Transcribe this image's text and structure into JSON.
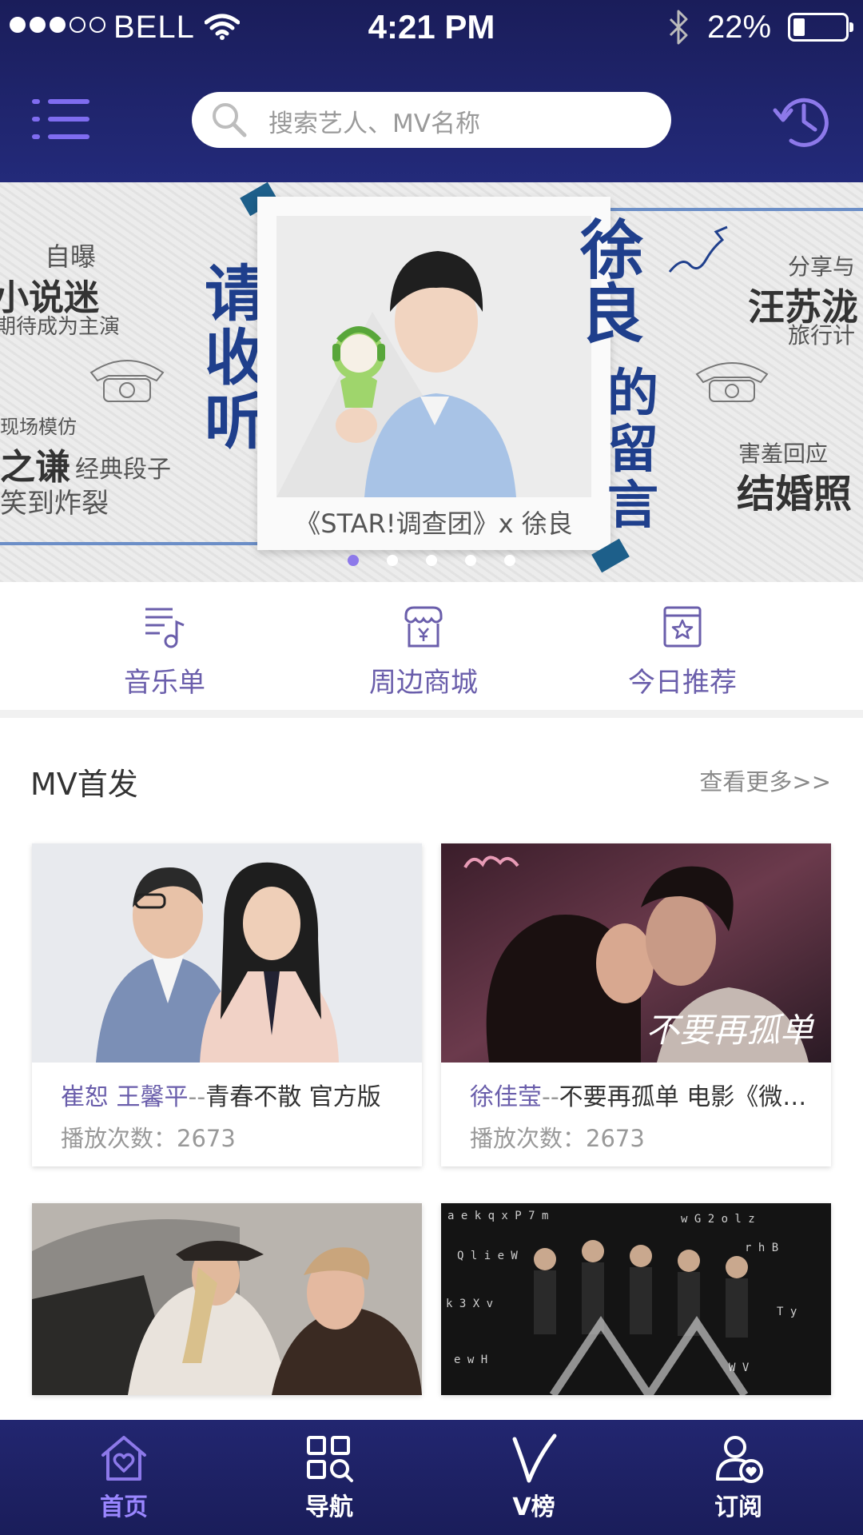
{
  "status_bar": {
    "carrier": "BELL",
    "time": "4:21 PM",
    "battery": "22%",
    "battery_level": 0.22,
    "signal_bars_on": 3,
    "signal_bars_total": 5
  },
  "header": {
    "menu_icon": "menu-list-icon",
    "search_placeholder": "搜索艺人、MV名称",
    "history_icon": "history-clock-icon"
  },
  "banner": {
    "left_lines": [
      "自曝",
      "小说迷",
      "期待成为主演",
      "现场模仿",
      "之谦",
      "经典段子",
      "笑到炸裂"
    ],
    "vertical_left": "请收听",
    "vertical_right_1": "徐良",
    "vertical_right_2": "的留言",
    "right_lines": [
      "分享与",
      "汪苏泷",
      "旅行计",
      "害羞回应",
      "结婚照"
    ],
    "photo_caption": "《STAR!调查团》x 徐良",
    "slides_total": 5,
    "active_slide": 1
  },
  "quick_entries": [
    {
      "label": "音乐单",
      "icon": "music-list-icon"
    },
    {
      "label": "周边商城",
      "icon": "shop-icon"
    },
    {
      "label": "今日推荐",
      "icon": "star-calendar-icon"
    }
  ],
  "mv_section": {
    "title": "MV首发",
    "more_link": "查看更多>>",
    "cards": [
      {
        "artist": "崔恕 王馨平",
        "separator": "--",
        "song": "青春不散  官方版",
        "plays": "播放次数：2673"
      },
      {
        "artist": "徐佳莹",
        "separator": "--",
        "song": "不要再孤单 电影《微微一笑很倾城》",
        "plays": "播放次数：2673"
      },
      {
        "artist": "",
        "separator": "",
        "song": "",
        "plays": ""
      },
      {
        "artist": "",
        "separator": "",
        "song": "",
        "plays": ""
      }
    ],
    "poster_text": "不要再孤单"
  },
  "tabbar": {
    "tabs": [
      {
        "label": "首页",
        "icon": "home-heart-icon",
        "active": true
      },
      {
        "label": "导航",
        "icon": "grid-search-icon",
        "active": false
      },
      {
        "label": "V榜",
        "icon": "v-chart-icon",
        "active": false
      },
      {
        "label": "订阅",
        "icon": "user-heart-icon",
        "active": false
      }
    ]
  },
  "colors": {
    "header_bg": "#1a1d5a",
    "accent": "#8d79ea",
    "label_purple": "#6a5eab"
  }
}
